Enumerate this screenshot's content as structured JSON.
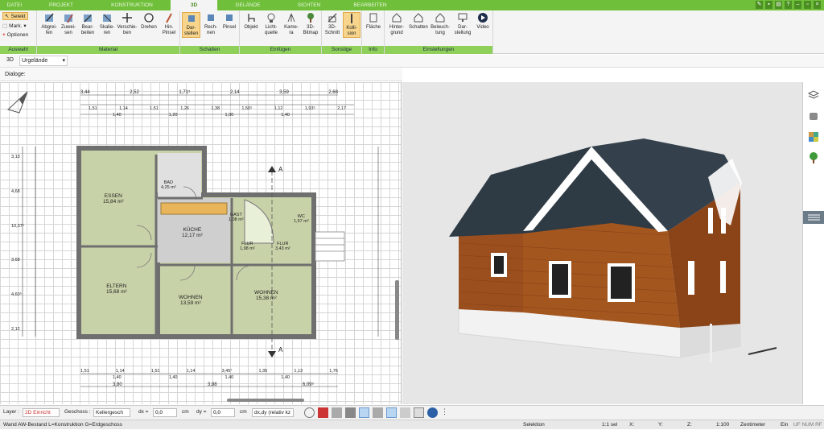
{
  "tabs": [
    "DATEI",
    "PROJEKT",
    "KONSTRUKTION",
    "3D",
    "GELÄNDE",
    "SICHTEN",
    "BEARBEITEN"
  ],
  "ribbon": {
    "auswahl": {
      "label": "Auswahl",
      "items": [
        "Selekt",
        "Mark.",
        "Optionen"
      ]
    },
    "material": {
      "label": "Material",
      "buttons": [
        "Abgrei-\nfen",
        "Zuwei-\nsen",
        "Bear-\nbeiten",
        "Skalie-\nren",
        "Verschie-\nben",
        "Drehen",
        "Hin.\nPinsel"
      ]
    },
    "schatten": {
      "label": "Schatten",
      "buttons": [
        "Dar-\nstellen",
        "Rech-\nnen",
        "Pinsel"
      ]
    },
    "einfuegen": {
      "label": "Einfügen",
      "buttons": [
        "Objekt",
        "Licht-\nquelle",
        "Kame-\nra",
        "3D-\nBitmap"
      ]
    },
    "sonstige": {
      "label": "Sonstige",
      "buttons": [
        "3D-\nSchnitt",
        "Kolli-\nsion"
      ]
    },
    "info": {
      "label": "Info",
      "buttons": [
        "Fläche"
      ]
    },
    "einstellungen": {
      "label": "Einstellungen",
      "buttons": [
        "Hinter-\ngrund",
        "Schatten",
        "Beleuch-\ntung",
        "Dar-\nstellung",
        "Video"
      ]
    }
  },
  "view_selector": {
    "mode": "3D",
    "value": "Urgelände"
  },
  "dialoge_label": "Dialoge:",
  "rooms": [
    {
      "name": "ESSEN",
      "area": "15,84 m²"
    },
    {
      "name": "BAD",
      "area": "4,25 m²"
    },
    {
      "name": "KÜCHE",
      "area": "12,17 m²"
    },
    {
      "name": "GAST",
      "area": "1,08 m²"
    },
    {
      "name": "WC",
      "area": "1,57 m²"
    },
    {
      "name": "FLUR",
      "area": "1,98 m²"
    },
    {
      "name": "FLUR",
      "area": "3,43 m²"
    },
    {
      "name": "ELTERN",
      "area": "15,68 m²"
    },
    {
      "name": "WOHNEN",
      "area": "13,59 m²"
    },
    {
      "name": "WOHNEN",
      "area": "15,38 m²"
    }
  ],
  "dims_top1": [
    "3,44",
    "2,52",
    "1,71⁵",
    "2,14",
    "3,59",
    "2,68"
  ],
  "dims_top2": [
    "1,51",
    "1,14",
    "1,51",
    "1,26",
    "1,38",
    "1,50⁵",
    "1,12",
    "1,93⁵",
    "2,17"
  ],
  "dims_top2b": [
    "1,40",
    "1,20",
    "1,00",
    "1,40"
  ],
  "dims_bottom1": [
    "1,51",
    "1,14",
    "1,51",
    "1,14",
    "3,45⁷",
    "1,35",
    "1,13",
    "1,76"
  ],
  "dims_bottom1b": [
    "1,40",
    "1,40",
    "1,40",
    "1,40"
  ],
  "dims_bottom2": [
    "3,80",
    "3,88",
    "6,09⁵"
  ],
  "dims_left": [
    "3,13",
    "4,68",
    "10,37⁵",
    "3,68",
    "4,60⁵",
    "2,12"
  ],
  "section_marker": "A",
  "toolbar2": {
    "layer_label": "Layer :",
    "layer_value": "2D Einricht",
    "geschoss_label": "Geschoss :",
    "geschoss_value": "Kellergesch",
    "dx_label": "dx =",
    "dx_value": "0,0",
    "dx_unit": "cm",
    "dy_label": "dy =",
    "dy_value": "0,0",
    "dy_unit": "cm",
    "mode_value": "dx,dy (relativ kz"
  },
  "status": {
    "left": "Wand AW-Bestand L=Konstruktion G=Erdgeschoss",
    "mode": "Selektion",
    "sel": "1:1 sel",
    "x": "X:",
    "y": "Y:",
    "z": "Z:",
    "scale": "1:100",
    "unit": "Zentimeter",
    "ein": "Ein",
    "flags": "UF NUM RF"
  },
  "colors": {
    "accent": "#6fbf3a",
    "ribbon_group": "#8fd05a",
    "room": "#c8d2a8",
    "wall": "#707070",
    "siding": "#9c4f1e",
    "roof": "#2e3a44"
  }
}
